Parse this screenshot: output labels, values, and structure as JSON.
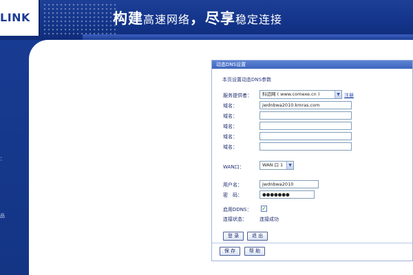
{
  "banner": {
    "logo_text": "LINK",
    "slogan_part1": "构建",
    "slogan_part2": "高速网络",
    "slogan_part3": "尽享",
    "slogan_part4": "稳定连接",
    "slogan_sep": "，"
  },
  "sidebar": {
    "items": [
      "：",
      "品"
    ]
  },
  "panel": {
    "title": "动态DNS设置",
    "description": "本页设置动态DNS参数",
    "provider_label": "服务提供者：",
    "provider_value": "科迈网 ( www.comexe.cn )",
    "register_link": "注册",
    "domain_label": "域名：",
    "domains": [
      "jwdnbwa2010.kmras.com",
      "",
      "",
      "",
      ""
    ],
    "wan_label": "WAN口：",
    "wan_value": "WAN 口 1",
    "username_label": "用户名：",
    "username_value": "jwdnbwa2010",
    "password_label": "密　码：",
    "password_value": "●●●●●●●",
    "enable_label": "启用DDNS：",
    "enable_checked": "✓",
    "status_label": "连接状态：",
    "status_value": "连接成功",
    "login_button": "登 录",
    "logout_button": "退 出",
    "save_button": "保 存",
    "help_button": "帮 助"
  },
  "colors": {
    "banner_blue": "#13348a",
    "panel_title": "#3c64bd",
    "text": "#1c2b6e"
  }
}
